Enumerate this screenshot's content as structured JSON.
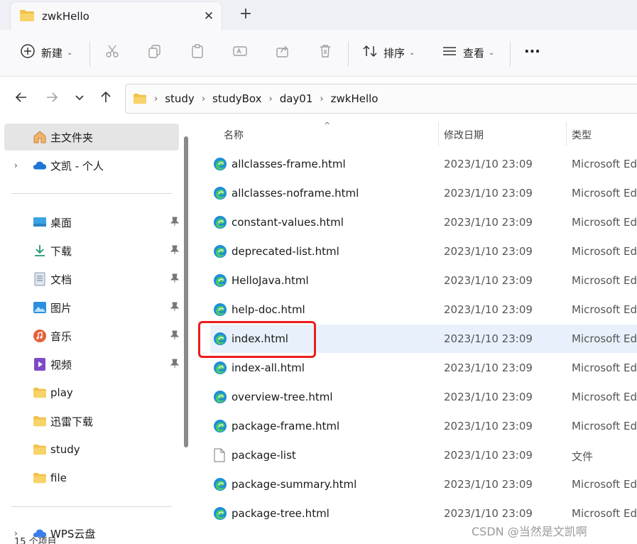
{
  "window": {
    "tab_title": "zwkHello",
    "tab_close": "✕",
    "tab_add": "+"
  },
  "toolbar": {
    "new_label": "新建",
    "sort_label": "排序",
    "view_label": "查看",
    "more_label": "···",
    "caret": "⌄"
  },
  "address": {
    "crumbs": [
      "study",
      "studyBox",
      "day01",
      "zwkHello"
    ],
    "sep": "›"
  },
  "sidebar": {
    "home": "主文件夹",
    "onedrive": "文凯 - 个人",
    "pinned": [
      {
        "label": "桌面",
        "icon": "desktop-icon"
      },
      {
        "label": "下载",
        "icon": "download-icon"
      },
      {
        "label": "文档",
        "icon": "documents-icon"
      },
      {
        "label": "图片",
        "icon": "pictures-icon"
      },
      {
        "label": "音乐",
        "icon": "music-icon"
      },
      {
        "label": "视频",
        "icon": "videos-icon"
      }
    ],
    "folders": [
      "play",
      "迅雷下载",
      "study",
      "file"
    ],
    "wps": "WPS云盘",
    "chevron": "›",
    "pin": "📌"
  },
  "columns": {
    "name": "名称",
    "modified": "修改日期",
    "type": "类型",
    "sort_caret": "^"
  },
  "files": [
    {
      "name": "allclasses-frame.html",
      "date": "2023/1/10 23:09",
      "type": "Microsoft Ed",
      "icon": "edge-icon"
    },
    {
      "name": "allclasses-noframe.html",
      "date": "2023/1/10 23:09",
      "type": "Microsoft Ed",
      "icon": "edge-icon"
    },
    {
      "name": "constant-values.html",
      "date": "2023/1/10 23:09",
      "type": "Microsoft Ed",
      "icon": "edge-icon"
    },
    {
      "name": "deprecated-list.html",
      "date": "2023/1/10 23:09",
      "type": "Microsoft Ed",
      "icon": "edge-icon"
    },
    {
      "name": "HelloJava.html",
      "date": "2023/1/10 23:09",
      "type": "Microsoft Ed",
      "icon": "edge-icon"
    },
    {
      "name": "help-doc.html",
      "date": "2023/1/10 23:09",
      "type": "Microsoft Ed",
      "icon": "edge-icon"
    },
    {
      "name": "index.html",
      "date": "2023/1/10 23:09",
      "type": "Microsoft Ed",
      "icon": "edge-icon"
    },
    {
      "name": "index-all.html",
      "date": "2023/1/10 23:09",
      "type": "Microsoft Ed",
      "icon": "edge-icon"
    },
    {
      "name": "overview-tree.html",
      "date": "2023/1/10 23:09",
      "type": "Microsoft Ed",
      "icon": "edge-icon"
    },
    {
      "name": "package-frame.html",
      "date": "2023/1/10 23:09",
      "type": "Microsoft Ed",
      "icon": "edge-icon"
    },
    {
      "name": "package-list",
      "date": "2023/1/10 23:09",
      "type": "文件",
      "icon": "file-icon"
    },
    {
      "name": "package-summary.html",
      "date": "2023/1/10 23:09",
      "type": "Microsoft Ed",
      "icon": "edge-icon"
    },
    {
      "name": "package-tree.html",
      "date": "2023/1/10 23:09",
      "type": "Microsoft Ed",
      "icon": "edge-icon"
    }
  ],
  "status": {
    "items": "15 个项目"
  },
  "watermark": "CSDN @当然是文凯啊",
  "colors": {
    "highlight": "#ee1c1c",
    "selected_row": "#e8f1fb",
    "folder": "#f2c14b",
    "edge": "#1d8fd6"
  }
}
